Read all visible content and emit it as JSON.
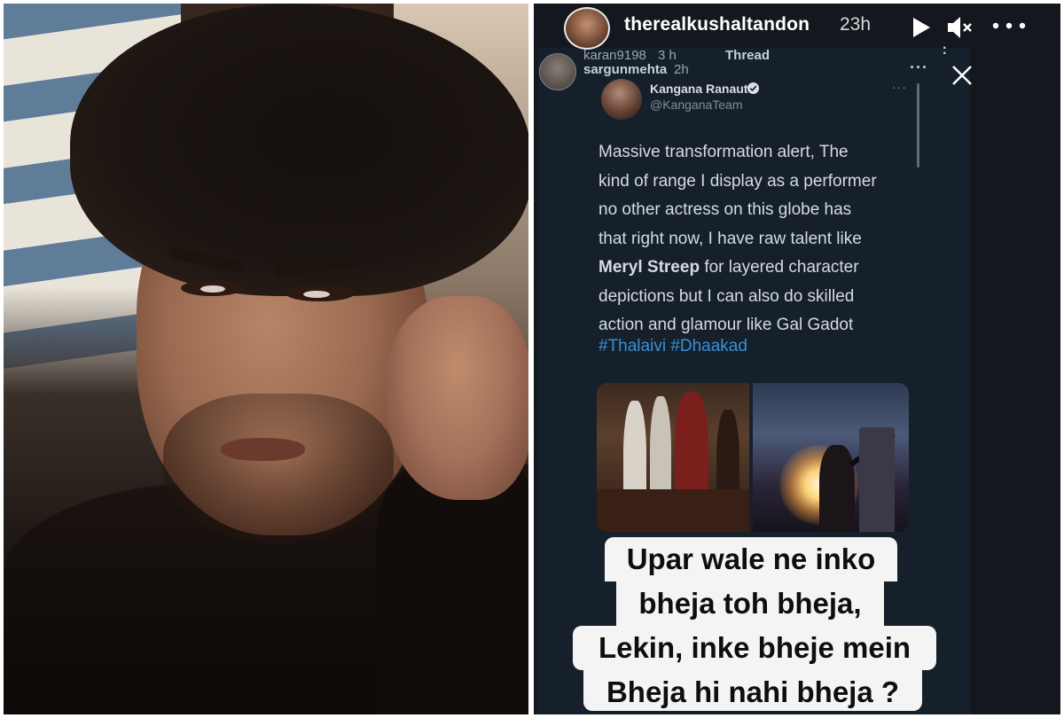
{
  "story": {
    "username": "therealkushaltandon",
    "time_ago": "23h",
    "icons": {
      "avatar": "profile-avatar",
      "play": "play-icon",
      "mute": "mute-icon",
      "more": "more-icon",
      "close": "close-icon"
    }
  },
  "screenshot": {
    "rows": [
      {
        "user": "karan9198",
        "time": "3 h"
      },
      {
        "user": "sargunmehta",
        "time": "2h"
      }
    ],
    "thread_label": "Thread",
    "more": "···"
  },
  "tweet": {
    "name": "Kangana Ranaut",
    "handle": "@KanganaTeam",
    "more": "···",
    "body_lines": [
      "Massive transformation alert, The",
      "kind of range I display as a performer",
      "no other actress on this globe has",
      "that right now, I have raw talent like"
    ],
    "body_bold": "Meryl Streep",
    "body_after_bold": " for layered character",
    "body_tail": [
      "depictions but I can also do skilled",
      "action and glamour like Gal Gadot"
    ],
    "hashtags": "#Thalaivi #Dhaakad"
  },
  "caption": {
    "lines": [
      "Upar wale ne inko",
      "bheja toh bheja,",
      "Lekin, inke bheje mein",
      "Bheja hi nahi bheja ?"
    ]
  },
  "colors": {
    "story_bg": "#14181e",
    "tweet_bg": "#15202b",
    "hashtag": "#3b8fd4",
    "caption_bg": "#f4f4f4"
  }
}
